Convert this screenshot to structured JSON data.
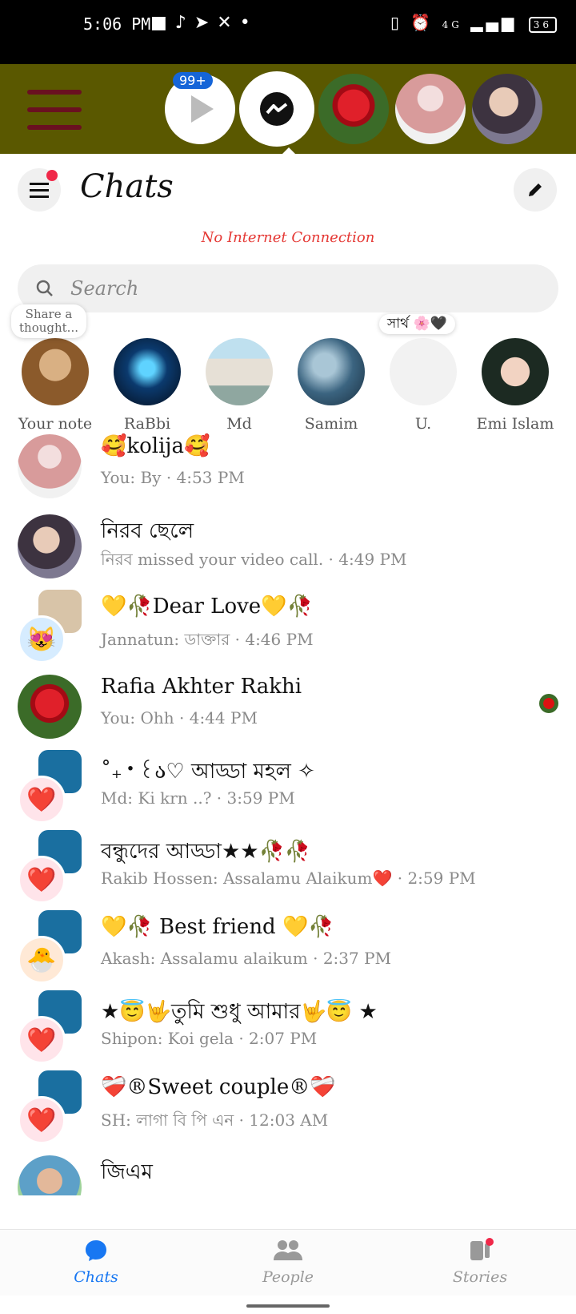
{
  "status_bar": {
    "time": "5:06 PM",
    "battery": "36",
    "network": "4G"
  },
  "launcher": {
    "badge": "99+"
  },
  "header": {
    "title": "Chats",
    "connection_warning": "No Internet Connection"
  },
  "search": {
    "placeholder": "Search"
  },
  "notes": [
    {
      "name": "Your note",
      "thought": "Share a thought..."
    },
    {
      "name": "RaBbi"
    },
    {
      "name": "Md"
    },
    {
      "name": "Samim"
    },
    {
      "name": "U.",
      "thought": "সার্থ 🌸🖤"
    },
    {
      "name": "Emi Islam"
    }
  ],
  "chats": [
    {
      "name": "🥰kolija🥰",
      "preview": "You: By · 4:53 PM"
    },
    {
      "name": "নিরব ছেলে",
      "preview": "নিরব missed your video call. · 4:49 PM"
    },
    {
      "name": "💛🥀Dear Love💛🥀",
      "preview": "Jannatun: ডাক্তার · 4:46 PM"
    },
    {
      "name": "Rafia Akhter Rakhi",
      "preview": "You: Ohh · 4:44 PM"
    },
    {
      "name": "˚₊‧꒰ა♡ আড্ডা মহল ✧",
      "preview": "Md: Ki krn ..? · 3:59 PM"
    },
    {
      "name": "বন্ধুদের আড্ডা★★🥀🥀",
      "preview": "Rakib Hossen: Assalamu Alaikum❤️ · 2:59 PM"
    },
    {
      "name": "💛🥀 Best friend 💛🥀",
      "preview": "Akash: Assalamu alaikum · 2:37 PM"
    },
    {
      "name": "★😇🤟তুমি শুধু আমার🤟😇 ★",
      "preview": "Shipon: Koi gela · 2:07 PM"
    },
    {
      "name": "❤️‍🩹®Sweet couple®❤️‍🩹",
      "preview": "SH: লাগা বি পি এন · 12:03 AM"
    },
    {
      "name": "জিএম",
      "preview": ""
    }
  ],
  "tabs": [
    {
      "label": "Chats",
      "active": true
    },
    {
      "label": "People"
    },
    {
      "label": "Stories"
    }
  ],
  "colors": {
    "accent": "#1877f2",
    "launcher_bg": "#5a5800",
    "badge_red": "#f02849"
  }
}
